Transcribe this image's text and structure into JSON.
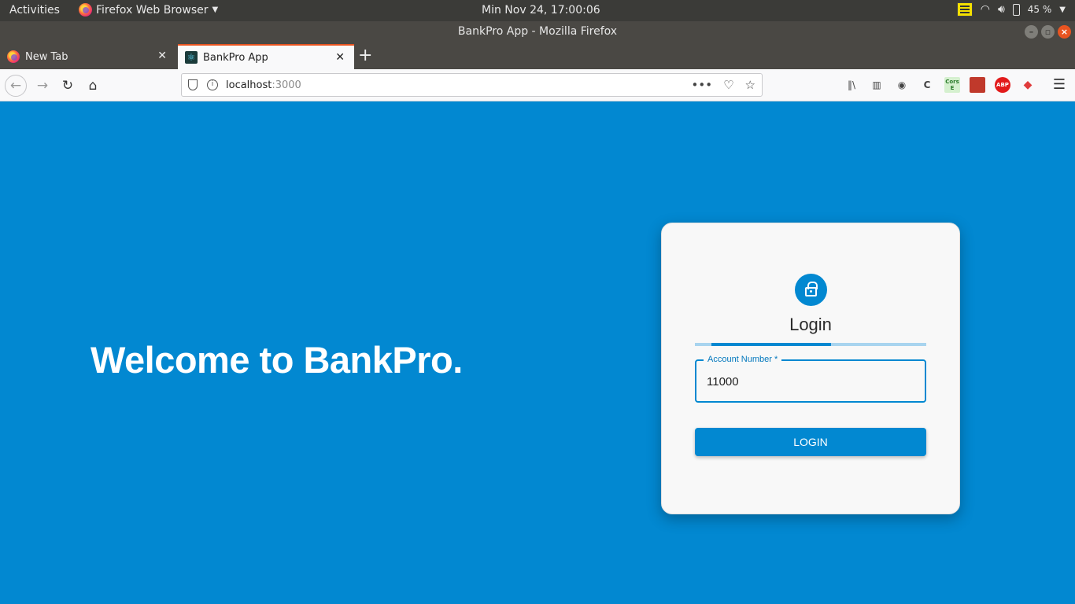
{
  "system": {
    "activities": "Activities",
    "app_menu": "Firefox Web Browser",
    "clock": "Min Nov 24, 17:00:06",
    "battery": "45 %"
  },
  "window": {
    "title": "BankPro App - Mozilla Firefox"
  },
  "tabs": [
    {
      "label": "New Tab",
      "active": false
    },
    {
      "label": "BankPro App",
      "active": true
    }
  ],
  "urlbar": {
    "host": "localhost",
    "port": ":3000"
  },
  "toolbar_icons": {
    "cors_label_1": "Cors",
    "cors_label_2": "E",
    "abp_label": "ABP"
  },
  "page": {
    "welcome": "Welcome to BankPro.",
    "login_card": {
      "title": "Login",
      "progress_start": 0.07,
      "progress_end": 0.59,
      "account_label": "Account Number *",
      "account_value": "11000",
      "login_button": "LOGIN"
    }
  },
  "colors": {
    "accent": "#0288d1",
    "topbar": "#3b3b38"
  }
}
